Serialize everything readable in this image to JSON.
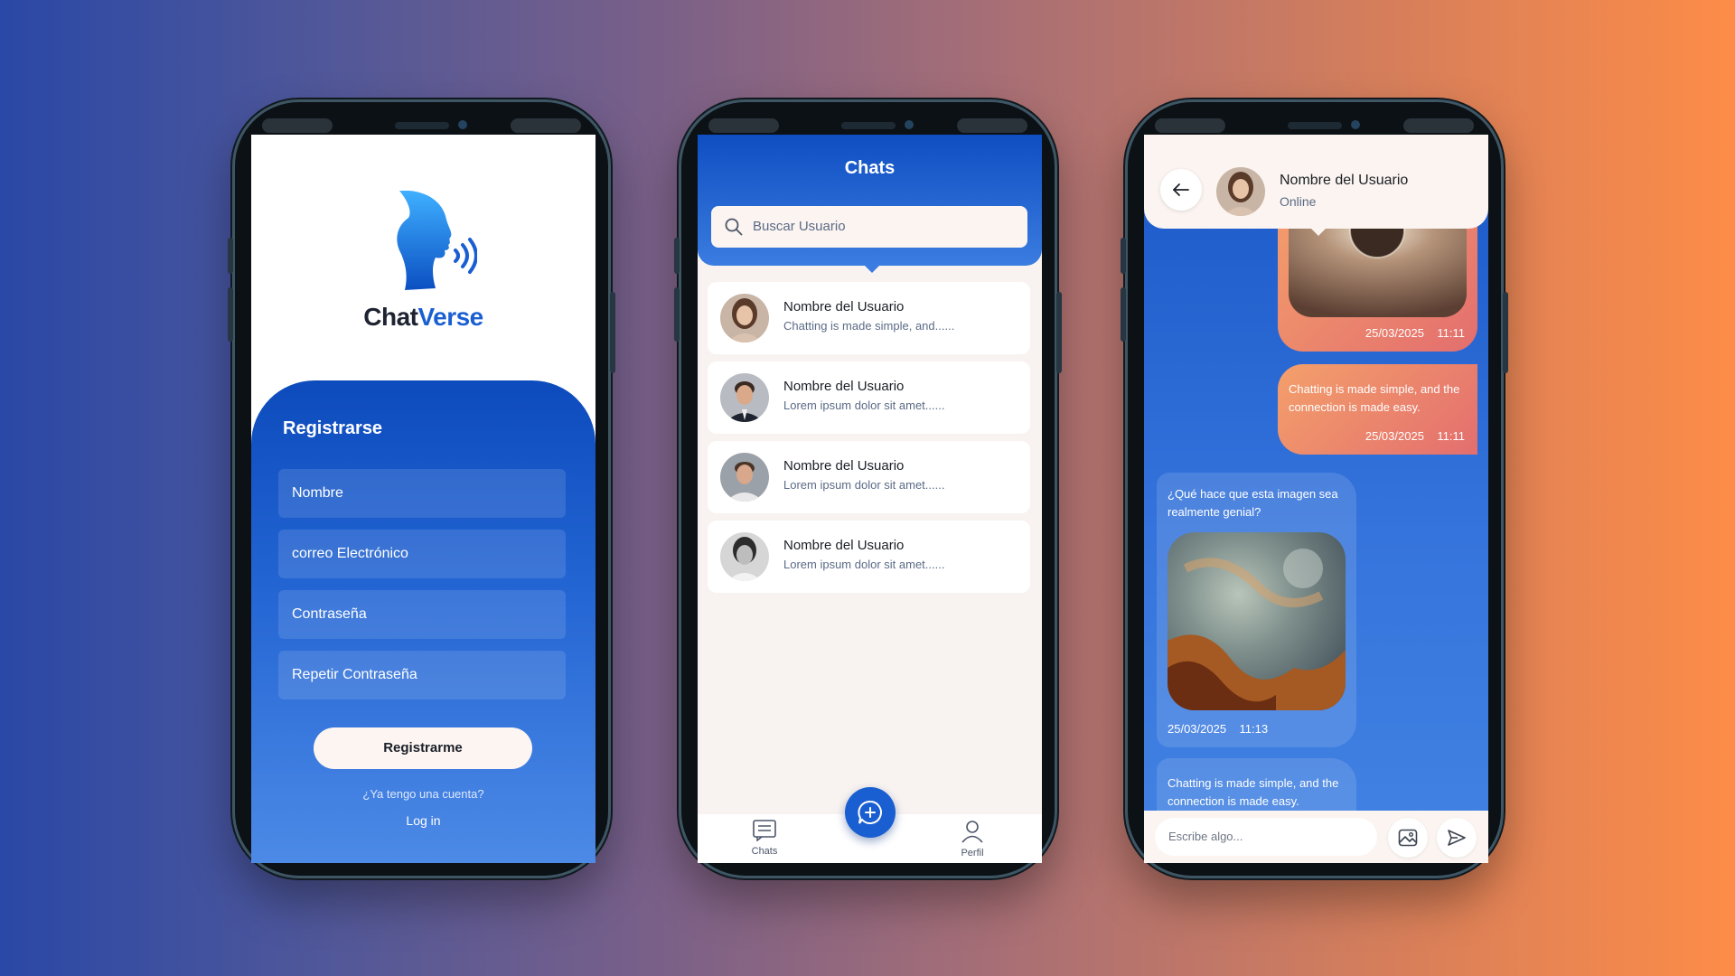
{
  "register": {
    "logo_part1": "Chat",
    "logo_part2": "Verse",
    "title": "Registrarse",
    "fields": [
      {
        "placeholder": "Nombre"
      },
      {
        "placeholder": "correo Electrónico"
      },
      {
        "placeholder": "Contraseña"
      },
      {
        "placeholder": "Repetir Contraseña"
      }
    ],
    "submit_label": "Registrarme",
    "account_question": "¿Ya tengo una cuenta?",
    "login_label": "Log in"
  },
  "chats": {
    "title": "Chats",
    "search_placeholder": "Buscar Usuario",
    "items": [
      {
        "name": "Nombre del Usuario",
        "preview": "Chatting is made simple, and......"
      },
      {
        "name": "Nombre del Usuario",
        "preview": "Lorem ipsum dolor sit amet......"
      },
      {
        "name": "Nombre del Usuario",
        "preview": "Lorem ipsum dolor sit amet......"
      },
      {
        "name": "Nombre del Usuario",
        "preview": "Lorem ipsum dolor sit amet......"
      }
    ],
    "nav": {
      "chats_label": "Chats",
      "profile_label": "Perfil"
    }
  },
  "conversation": {
    "contact_name": "Nombre del Usuario",
    "contact_status": "Online",
    "messages": [
      {
        "direction": "out",
        "type": "image",
        "date": "25/03/2025",
        "time": "11:11"
      },
      {
        "direction": "out",
        "type": "text",
        "text": "Chatting is made simple, and the connection is made easy.",
        "date": "25/03/2025",
        "time": "11:11"
      },
      {
        "direction": "in",
        "type": "image",
        "text": "¿Qué hace que esta imagen sea realmente genial?",
        "date": "25/03/2025",
        "time": "11:13"
      },
      {
        "direction": "in",
        "type": "text",
        "text": "Chatting is made simple, and the connection is made easy."
      }
    ],
    "composer_placeholder": "Escribe algo..."
  },
  "colors": {
    "brand_blue": "#1a5fd1",
    "brand_dark": "#1d2330",
    "outgoing_start": "#f4a06b",
    "outgoing_end": "#e36e6e",
    "cream": "#fbf4f0"
  }
}
